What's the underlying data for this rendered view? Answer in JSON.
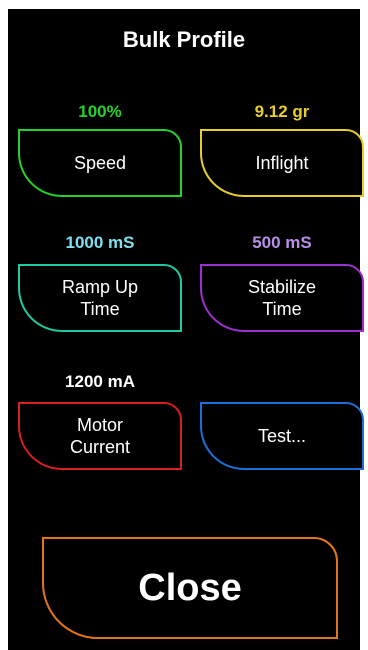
{
  "header": {
    "title": "Bulk Profile"
  },
  "colors": {
    "background": "#000000",
    "speed": "#22d22a",
    "inflight": "#e6cf2a",
    "ramp_up": "#22c9a0",
    "stabilize": "#9b2fd0",
    "motor_current": "#d81e1e",
    "test": "#1c6fd8",
    "close": "#e2741c",
    "ramp_up_value": "#7fe0f0",
    "stabilize_value": "#b98ee6",
    "motor_current_value": "#ffffff"
  },
  "settings": [
    {
      "value": "100%",
      "label": "Speed"
    },
    {
      "value": "9.12 gr",
      "label": "Inflight"
    },
    {
      "value": "1000 mS",
      "label": "Ramp Up\nTime"
    },
    {
      "value": "500 mS",
      "label": "Stabilize\nTime"
    },
    {
      "value": "1200 mA",
      "label": "Motor\nCurrent"
    },
    {
      "value": "",
      "label": "Test..."
    }
  ],
  "close_label": "Close"
}
